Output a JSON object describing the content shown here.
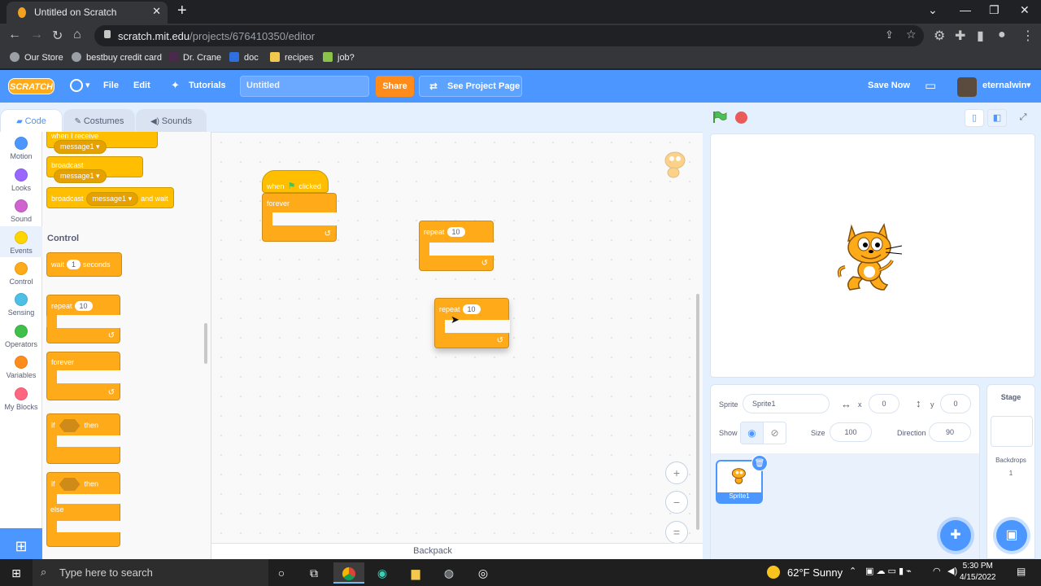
{
  "browser": {
    "tab_title": "Untitled on Scratch",
    "url_host": "scratch.mit.edu",
    "url_path": "/projects/676410350/editor",
    "bookmarks": [
      "Our Store",
      "bestbuy credit card",
      "Dr. Crane",
      "doc",
      "recipes",
      "job?"
    ]
  },
  "menubar": {
    "logo": "SCRATCH",
    "file": "File",
    "edit": "Edit",
    "tutorials": "Tutorials",
    "project_title": "Untitled",
    "share": "Share",
    "see_project": "See Project Page",
    "save_now": "Save Now",
    "username": "eternalwin"
  },
  "tabs": {
    "code": "Code",
    "costumes": "Costumes",
    "sounds": "Sounds"
  },
  "categories": [
    {
      "label": "Motion",
      "color": "#4c97ff"
    },
    {
      "label": "Looks",
      "color": "#9966ff"
    },
    {
      "label": "Sound",
      "color": "#cf63cf"
    },
    {
      "label": "Events",
      "color": "#ffd500"
    },
    {
      "label": "Control",
      "color": "#ffab19"
    },
    {
      "label": "Sensing",
      "color": "#4cbfe6"
    },
    {
      "label": "Operators",
      "color": "#40bf4a"
    },
    {
      "label": "Variables",
      "color": "#ff8c1a"
    },
    {
      "label": "My Blocks",
      "color": "#ff6680"
    }
  ],
  "palette": {
    "when_receive": "when I receive",
    "message": "message1",
    "broadcast": "broadcast",
    "and_wait": "and wait",
    "control_title": "Control",
    "wait": "wait",
    "wait_val": "1",
    "seconds": "seconds",
    "repeat": "repeat",
    "repeat_val": "10",
    "forever": "forever",
    "if": "if",
    "then": "then",
    "else": "else"
  },
  "workspace": {
    "when": "when",
    "clicked": "clicked",
    "forever": "forever",
    "repeat": "repeat",
    "repeat_val": "10",
    "backpack": "Backpack",
    "zoom_in": "+",
    "zoom_out": "−",
    "zoom_reset": "="
  },
  "sprite": {
    "sprite_label": "Sprite",
    "name": "Sprite1",
    "x_label": "x",
    "x": "0",
    "y_label": "y",
    "y": "0",
    "show_label": "Show",
    "size_label": "Size",
    "size": "100",
    "direction_label": "Direction",
    "direction": "90",
    "thumb_name": "Sprite1"
  },
  "stagepanel": {
    "title": "Stage",
    "backdrops_label": "Backdrops",
    "backdrops_count": "1"
  },
  "taskbar": {
    "search_placeholder": "Type here to search",
    "weather": "62°F  Sunny",
    "time": "5:30 PM",
    "date": "4/15/2022"
  }
}
